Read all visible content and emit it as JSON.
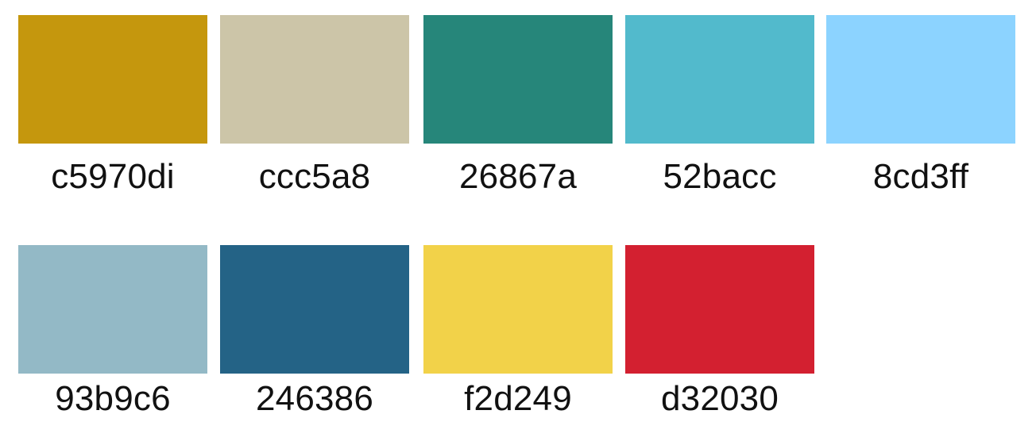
{
  "swatches": [
    {
      "label": "c5970di",
      "color": "#c5970d"
    },
    {
      "label": "ccc5a8",
      "color": "#ccc5a8"
    },
    {
      "label": "26867a",
      "color": "#26867a"
    },
    {
      "label": "52bacc",
      "color": "#52bacc"
    },
    {
      "label": "8cd3ff",
      "color": "#8cd3ff"
    },
    {
      "label": "93b9c6",
      "color": "#93b9c6"
    },
    {
      "label": "246386",
      "color": "#246386"
    },
    {
      "label": "f2d249",
      "color": "#f2d249"
    },
    {
      "label": "d32030",
      "color": "#d32030"
    }
  ]
}
